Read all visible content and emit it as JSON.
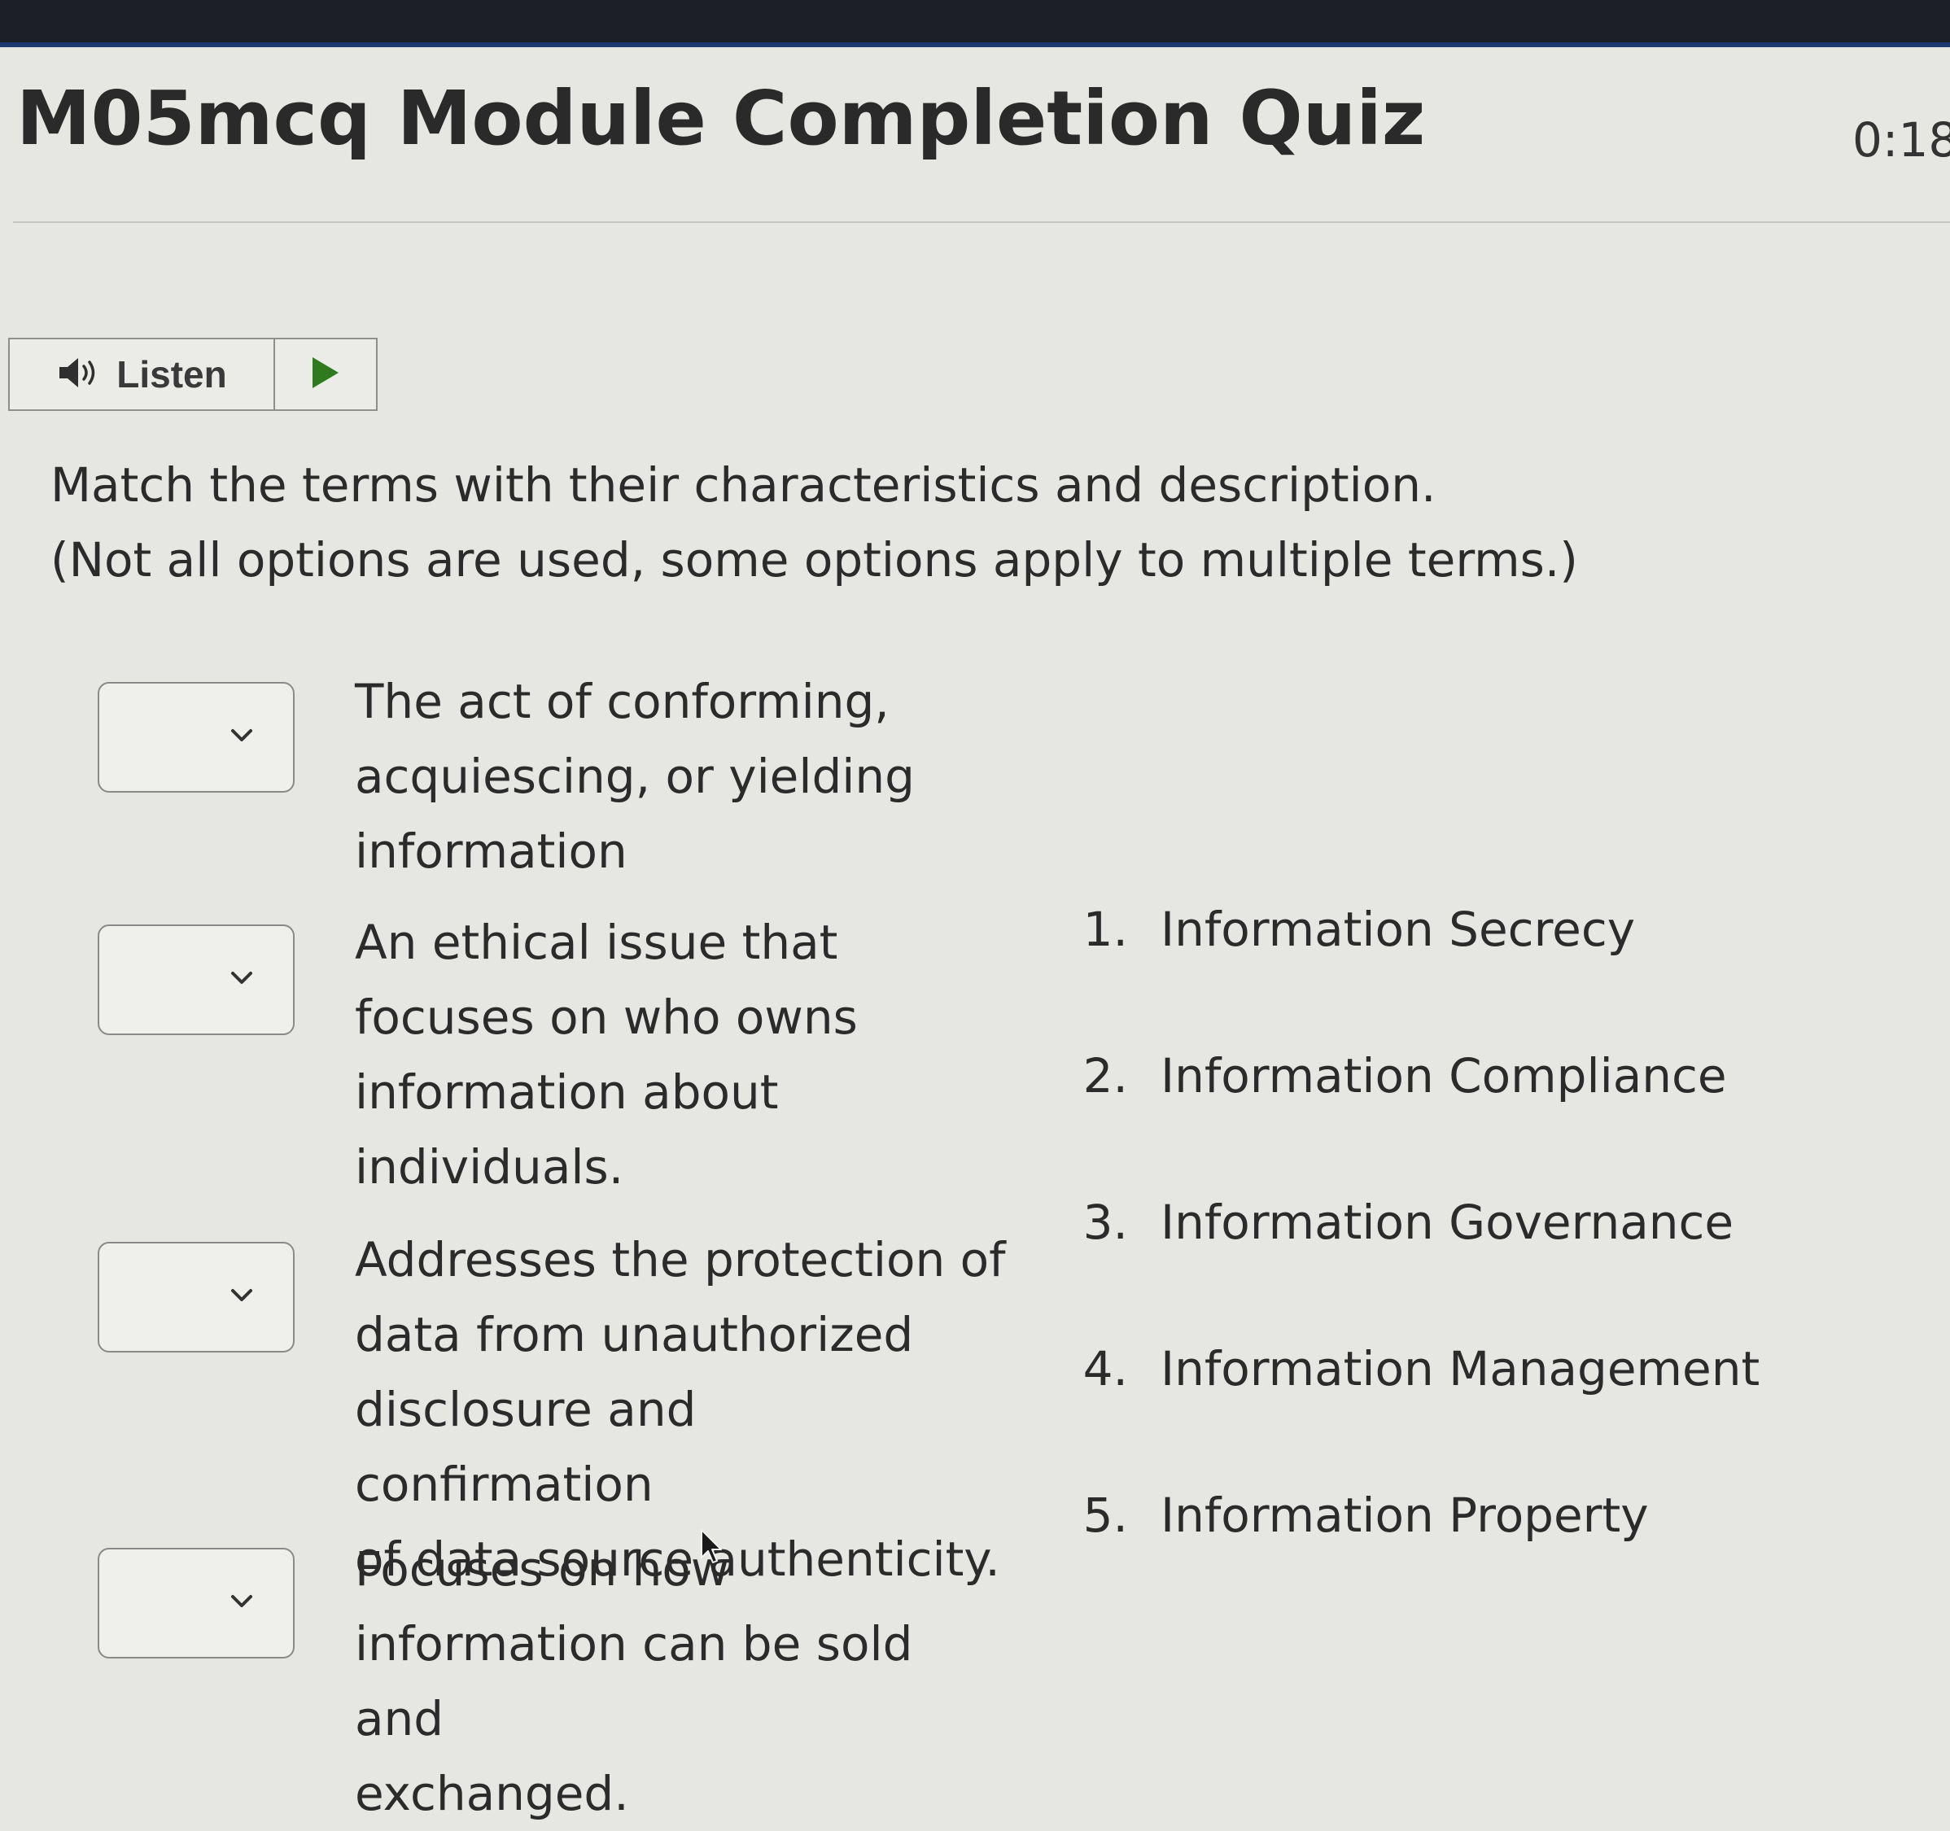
{
  "quiz": {
    "title": "M05mcq Module Completion Quiz",
    "timer": "0:18"
  },
  "listen": {
    "label": "Listen",
    "speaker_icon": "speaker-icon",
    "play_icon": "play-icon"
  },
  "question": {
    "instruction_line1": "Match the terms with their characteristics and description.",
    "instruction_line2": "(Not all options are used, some options apply to multiple terms.)"
  },
  "matches": [
    {
      "selected": "",
      "description_lines": [
        "The act of conforming,",
        "acquiescing, or yielding",
        "information"
      ]
    },
    {
      "selected": "",
      "description_lines": [
        "An ethical issue that",
        "focuses on who owns",
        "information about",
        "individuals."
      ]
    },
    {
      "selected": "",
      "description_lines": [
        "Addresses the protection of",
        "data from unauthorized",
        "disclosure and confirmation",
        "of data source authenticity."
      ]
    },
    {
      "selected": "",
      "description_lines": [
        "Focuses on how",
        "information can be sold and",
        "exchanged."
      ]
    }
  ],
  "options": [
    {
      "number": "1.",
      "label": "Information Secrecy"
    },
    {
      "number": "2.",
      "label": "Information Compliance"
    },
    {
      "number": "3.",
      "label": "Information Governance"
    },
    {
      "number": "4.",
      "label": "Information Management"
    },
    {
      "number": "5.",
      "label": "Information Property"
    }
  ],
  "colors": {
    "background": "#e6e6e3",
    "top_bar": "#1d1f26",
    "accent_play": "#2f7a1f",
    "text": "#2b2b2b"
  }
}
